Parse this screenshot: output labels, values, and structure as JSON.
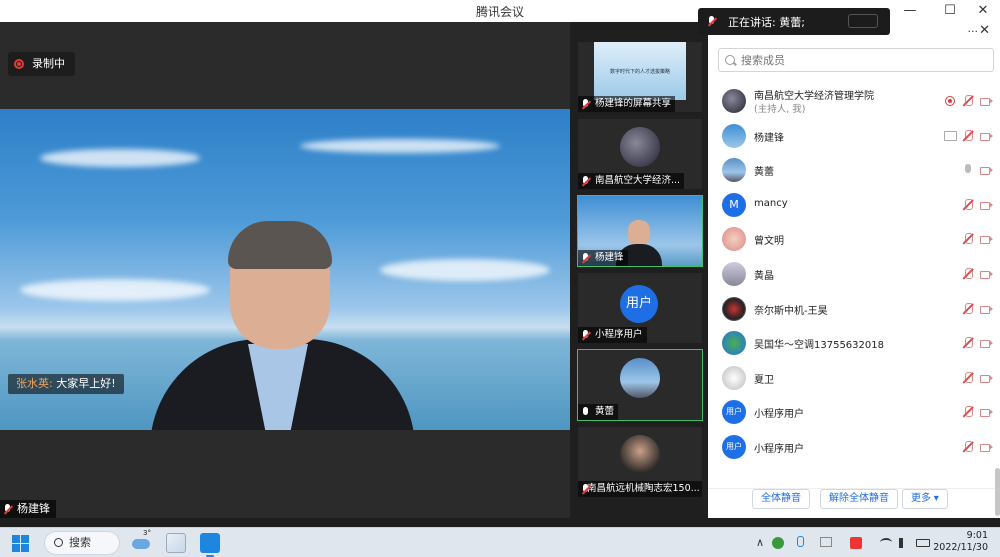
{
  "window": {
    "title": "腾讯会议",
    "min": "—",
    "max": "☐",
    "close": "✕"
  },
  "recording": {
    "label": "录制中"
  },
  "speaking_toast": {
    "text": "正在讲话: 黄蕾;"
  },
  "chat_overlay": {
    "sender": "张水英:",
    "message": "大家早上好!"
  },
  "main_video": {
    "name": "杨建锋"
  },
  "thumbnails": [
    {
      "label": "杨建锋的屏幕共享",
      "slide_title": "数字时代下的人才选拔策略"
    },
    {
      "label": "南昌航空大学经济..."
    },
    {
      "label": "杨建锋"
    },
    {
      "label": "小程序用户",
      "avatar_text": "用户"
    },
    {
      "label": "黄蕾"
    },
    {
      "label": "南昌航远机械陶志宏150..."
    }
  ],
  "panel": {
    "more": "···",
    "close": "✕",
    "search_placeholder": "搜索成员",
    "members": [
      {
        "name": "南昌航空大学经济管理学院",
        "role": "(主持人, 我)"
      },
      {
        "name": "杨建锋"
      },
      {
        "name": "黄蕾"
      },
      {
        "name": "mancy",
        "avatar_text": "M"
      },
      {
        "name": "曾文明"
      },
      {
        "name": "黄晶"
      },
      {
        "name": "奈尔斯中机-王昊"
      },
      {
        "name": "吴国华～空调13755632018"
      },
      {
        "name": "夏卫"
      },
      {
        "name": "小程序用户",
        "avatar_text": "用户"
      },
      {
        "name": "小程序用户",
        "avatar_text": "用户"
      }
    ],
    "actions": {
      "mute_all": "全体静音",
      "unmute_all": "解除全体静音",
      "more": "更多 ▾"
    }
  },
  "taskbar": {
    "search": "搜索",
    "weather_temp": "3°",
    "time": "9:01",
    "date": "2022/11/30",
    "tray_caret": "∧"
  },
  "colors": {
    "accent": "#1e6fe6",
    "recording": "#e23b3b",
    "active_tile": "#3fbf6a"
  }
}
